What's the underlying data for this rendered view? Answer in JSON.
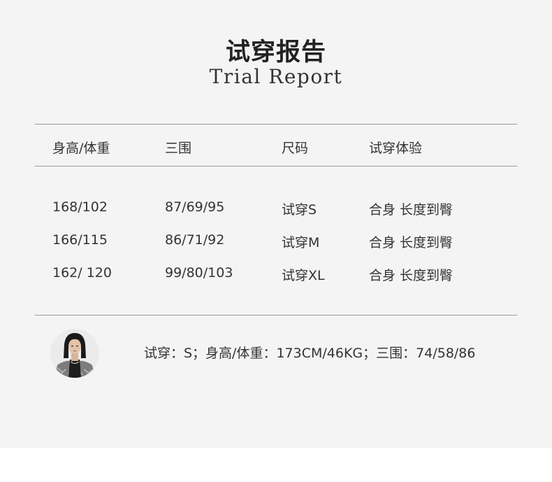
{
  "header": {
    "title_cn": "试穿报告",
    "title_en": "Trial Report"
  },
  "table": {
    "columns": [
      "身高/体重",
      "三围",
      "尺码",
      "试穿体验"
    ],
    "rows": [
      [
        "168/102",
        "87/69/95",
        "试穿S",
        "合身 长度到臀"
      ],
      [
        "166/115",
        "86/71/92",
        "试穿M",
        "合身 长度到臀"
      ],
      [
        "162/ 120",
        "99/80/103",
        "试穿XL",
        "合身 长度到臀"
      ]
    ]
  },
  "model": {
    "info": "试穿：S；身高/体重：173CM/46KG；三围：74/58/86"
  },
  "colors": {
    "panel_background": "#f4f4f4",
    "rule": "#9a9a9a",
    "text": "#333333"
  }
}
